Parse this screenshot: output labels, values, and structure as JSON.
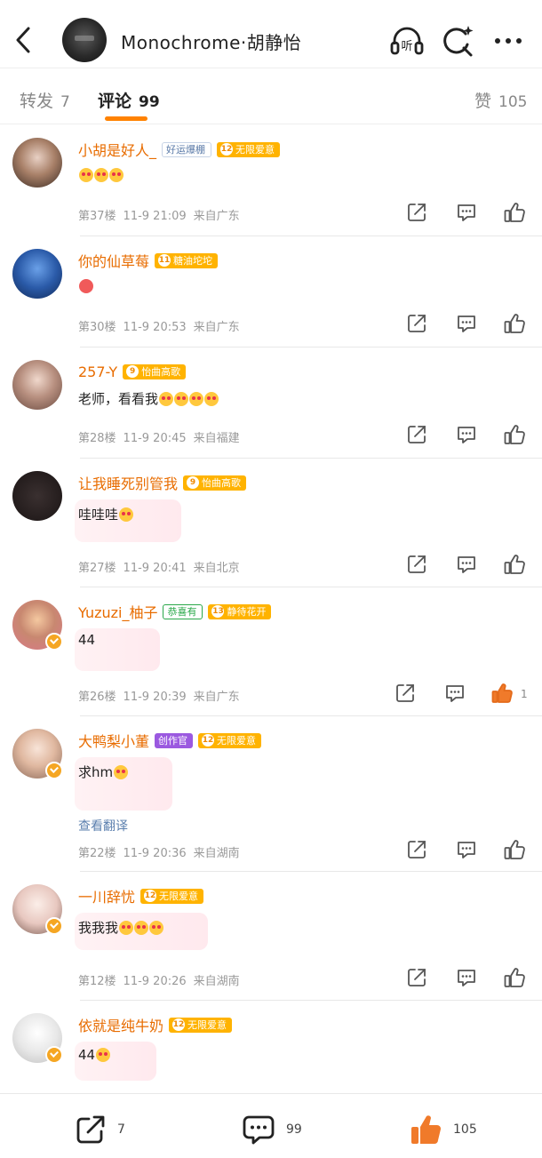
{
  "header": {
    "title": "Monochrome·胡静怡",
    "icons": [
      "back-arrow-icon",
      "listen-headphones-icon",
      "ai-search-icon",
      "more-icon"
    ],
    "listen_label": "听"
  },
  "tabs": {
    "repost": {
      "label": "转发",
      "count": "7"
    },
    "comments": {
      "label": "评论",
      "count": "99"
    },
    "likes": {
      "label": "赞",
      "count": "105"
    }
  },
  "comments": [
    {
      "user": "小胡是好人_",
      "badges": [
        {
          "type": "gray",
          "text": "好运爆棚"
        },
        {
          "type": "level",
          "level": "12",
          "text": "无限爱意"
        }
      ],
      "text": "",
      "emoji_count": 3,
      "floor": "第37楼",
      "time": "11-9 21:09",
      "location": "来自广东",
      "likes": ""
    },
    {
      "user": "你的仙草莓",
      "badges": [
        {
          "type": "level",
          "level": "11",
          "text": "糖油坨坨"
        }
      ],
      "text": "",
      "emoji_count": 1,
      "floor": "第30楼",
      "time": "11-9 20:53",
      "location": "来自广东",
      "likes": ""
    },
    {
      "user": "257-Y",
      "badges": [
        {
          "type": "level",
          "level": "9",
          "text": "怡曲高歌"
        }
      ],
      "text": "老师，看看我",
      "emoji_count": 4,
      "floor": "第28楼",
      "time": "11-9 20:45",
      "location": "来自福建",
      "likes": ""
    },
    {
      "user": "让我睡死别管我",
      "badges": [
        {
          "type": "level",
          "level": "9",
          "text": "怡曲高歌"
        }
      ],
      "text": "哇哇哇",
      "emoji_count": 1,
      "floor": "第27楼",
      "time": "11-9 20:41",
      "location": "来自北京",
      "likes": ""
    },
    {
      "user": "Yuzuzi_柚子",
      "badges": [
        {
          "type": "green",
          "text": "恭喜有"
        },
        {
          "type": "level",
          "level": "13",
          "text": "静待花开"
        }
      ],
      "text": "44",
      "emoji_count": 0,
      "floor": "第26楼",
      "time": "11-9 20:39",
      "location": "来自广东",
      "likes": "1"
    },
    {
      "user": "大鸭梨小董",
      "badges": [
        {
          "type": "purple",
          "text": "创作官"
        },
        {
          "type": "level",
          "level": "12",
          "text": "无限爱意"
        }
      ],
      "text": "求hm",
      "emoji_count": 1,
      "translate": "查看翻译",
      "floor": "第22楼",
      "time": "11-9 20:36",
      "location": "来自湖南",
      "likes": ""
    },
    {
      "user": "一川辞忧",
      "badges": [
        {
          "type": "level",
          "level": "12",
          "text": "无限爱意"
        }
      ],
      "text": "我我我",
      "emoji_count": 3,
      "floor": "第12楼",
      "time": "11-9 20:26",
      "location": "来自湖南",
      "likes": ""
    },
    {
      "user": "依就是纯牛奶",
      "badges": [
        {
          "type": "level",
          "level": "12",
          "text": "无限爱意"
        }
      ],
      "text": "44",
      "emoji_count": 1,
      "floor": "",
      "time": "",
      "location": "",
      "likes": ""
    }
  ],
  "bottombar": {
    "repost_count": "7",
    "comment_count": "99",
    "like_count": "105"
  },
  "colors": {
    "accent": "#ff8200",
    "username": "#e86c00",
    "like_active": "#f07a2a"
  }
}
